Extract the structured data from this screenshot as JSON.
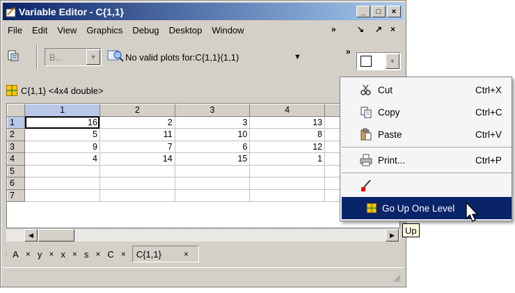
{
  "window": {
    "title": "Variable Editor - C{1,1}",
    "min": "_",
    "max": "□",
    "close": "×"
  },
  "menu": [
    "File",
    "Edit",
    "View",
    "Graphics",
    "Debug",
    "Desktop",
    "Window"
  ],
  "menu_right": {
    "more": "»",
    "dock": "↘",
    "undock": "↗",
    "close": "×"
  },
  "toolbar": {
    "combo_text": "B...",
    "plot_text": "No valid plots for:C{1,1}(1,1)",
    "plot_arrow": "▼",
    "overflow": "»"
  },
  "path": {
    "label": "C{1,1} <4x4 double>"
  },
  "grid": {
    "columns": [
      "1",
      "2",
      "3",
      "4"
    ],
    "rows": [
      {
        "h": "1",
        "c": [
          "16",
          "2",
          "3",
          "13"
        ]
      },
      {
        "h": "2",
        "c": [
          "5",
          "11",
          "10",
          "8"
        ]
      },
      {
        "h": "3",
        "c": [
          "9",
          "7",
          "6",
          "12"
        ]
      },
      {
        "h": "4",
        "c": [
          "4",
          "14",
          "15",
          "1"
        ]
      },
      {
        "h": "5",
        "c": [
          "",
          "",
          "",
          ""
        ]
      },
      {
        "h": "6",
        "c": [
          "",
          "",
          "",
          ""
        ]
      },
      {
        "h": "7",
        "c": [
          "",
          "",
          "",
          ""
        ]
      }
    ]
  },
  "tabs": [
    {
      "label": "A",
      "x": "×"
    },
    {
      "label": "y",
      "x": "×"
    },
    {
      "label": "x",
      "x": "×"
    },
    {
      "label": "s",
      "x": "×"
    },
    {
      "label": "C",
      "x": "×"
    },
    {
      "label": "C{1,1}",
      "x": "×"
    }
  ],
  "context_menu": {
    "cut": {
      "label": "Cut",
      "shortcut": "Ctrl+X"
    },
    "copy": {
      "label": "Copy",
      "shortcut": "Ctrl+C"
    },
    "paste": {
      "label": "Paste",
      "shortcut": "Ctrl+V"
    },
    "print": {
      "label": "Print...",
      "shortcut": "Ctrl+P"
    },
    "go_up": {
      "label": "Go Up One Level"
    }
  },
  "tooltip": "Up",
  "colors": {
    "title_start": "#0a246a",
    "title_end": "#a6caf0",
    "highlight": "#0a246a",
    "grid_icon": "#ffc800"
  }
}
